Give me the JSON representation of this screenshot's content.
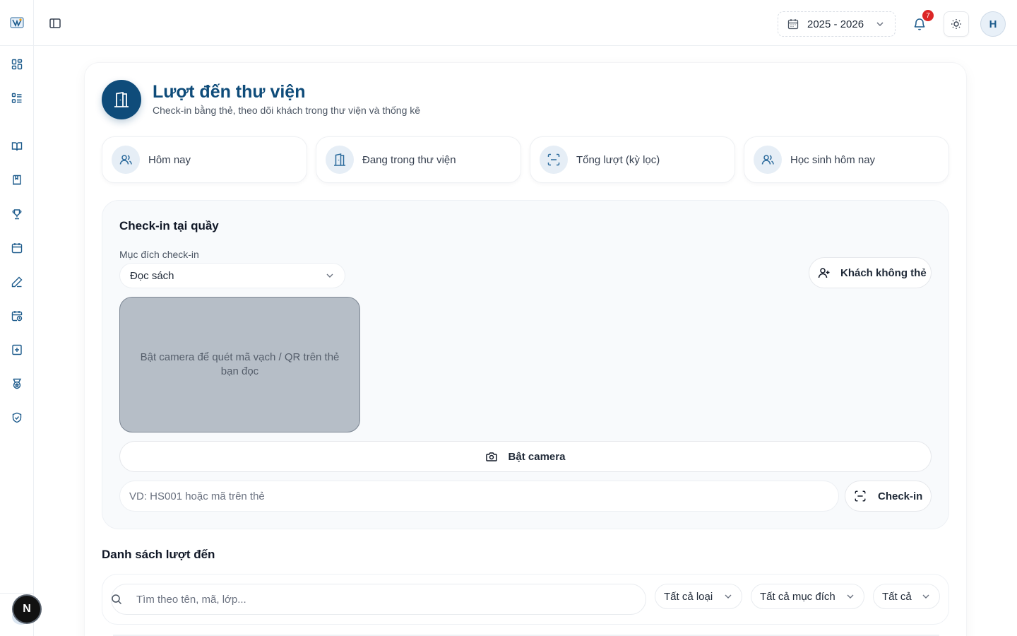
{
  "topbar": {
    "year": "2025 - 2026",
    "notification_count": "7",
    "user_initial": "H"
  },
  "sidebar": {
    "icons": [
      "dashboard-icon",
      "list-icon",
      "book-open-icon",
      "book-icon",
      "trophy-icon",
      "calendar-icon",
      "pen-icon",
      "calendar-clock-icon",
      "book-plus-icon",
      "medal-icon",
      "shield-check-icon"
    ],
    "bottom_badge": "N"
  },
  "header": {
    "title": "Lượt đến thư viện",
    "subtitle": "Check-in bằng thẻ, theo dõi khách trong thư viện và thống kê"
  },
  "stats": [
    {
      "label": "Hôm nay",
      "icon": "users-icon"
    },
    {
      "label": "Đang trong thư viện",
      "icon": "door-icon"
    },
    {
      "label": "Tổng lượt (kỳ lọc)",
      "icon": "scan-icon"
    },
    {
      "label": "Học sinh hôm nay",
      "icon": "users-icon"
    }
  ],
  "checkin": {
    "title": "Check-in tại quầy",
    "purpose_label": "Mục đích check-in",
    "purpose_value": "Đọc sách",
    "guest_button": "Khách không thẻ",
    "camera_hint": "Bật camera để quét mã vạch / QR trên thẻ bạn đọc",
    "camera_button": "Bật camera",
    "code_placeholder": "VD: HS001 hoặc mã trên thẻ",
    "checkin_button": "Check-in"
  },
  "visits": {
    "title": "Danh sách lượt đến",
    "search_placeholder": "Tìm theo tên, mã, lớp...",
    "filter_type": "Tất cả loại",
    "filter_purpose": "Tất cả mục đích",
    "filter_status": "Tất cả"
  },
  "colors": {
    "primary": "#0f4c7a",
    "badge": "#dc2626",
    "panel_bg": "#f8fafc"
  }
}
